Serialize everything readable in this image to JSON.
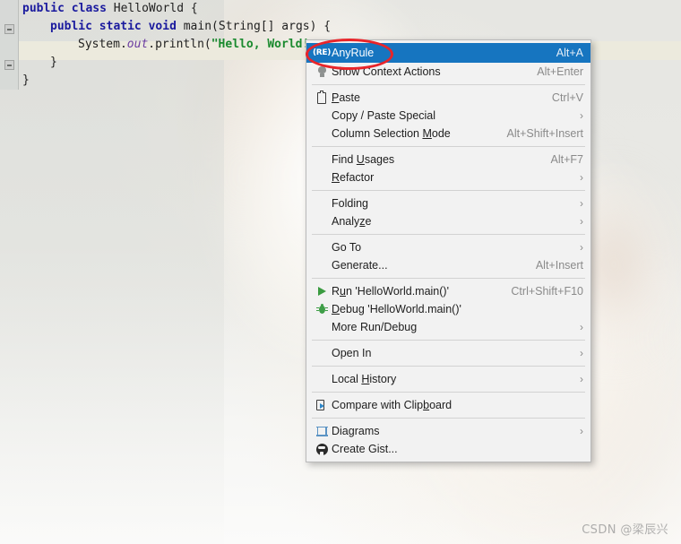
{
  "editor": {
    "lines": [
      {
        "indent": 0,
        "tokens": [
          {
            "t": "public",
            "c": "kw"
          },
          {
            "t": " ",
            "c": "pln"
          },
          {
            "t": "class",
            "c": "kw"
          },
          {
            "t": " HelloWorld {",
            "c": "pln"
          }
        ]
      },
      {
        "indent": 1,
        "tokens": [
          {
            "t": "public",
            "c": "kw"
          },
          {
            "t": " ",
            "c": "pln"
          },
          {
            "t": "static",
            "c": "kw"
          },
          {
            "t": " ",
            "c": "pln"
          },
          {
            "t": "void",
            "c": "kw"
          },
          {
            "t": " main(String[] args) {",
            "c": "pln"
          }
        ]
      },
      {
        "indent": 2,
        "tokens": [
          {
            "t": "System.",
            "c": "pln"
          },
          {
            "t": "out",
            "c": "fld"
          },
          {
            "t": ".println(",
            "c": "pln"
          },
          {
            "t": "\"Hello, World!",
            "c": "str"
          }
        ]
      },
      {
        "indent": 1,
        "tokens": [
          {
            "t": "}",
            "c": "pln"
          }
        ]
      },
      {
        "indent": 0,
        "tokens": [
          {
            "t": "}",
            "c": "pln"
          }
        ]
      }
    ],
    "highlighted_line_index": 2
  },
  "context_menu": {
    "groups": [
      {
        "items": [
          {
            "label": "AnyRule",
            "accel": "Alt+A",
            "icon": "anyrule-icon",
            "selected": true,
            "arrow": false,
            "mnemonic": ""
          },
          {
            "label": "Show Context Actions",
            "accel": "Alt+Enter",
            "icon": "lightbulb-icon",
            "selected": false,
            "arrow": false,
            "mnemonic": ""
          }
        ]
      },
      {
        "items": [
          {
            "label": "Paste",
            "accel": "Ctrl+V",
            "icon": "clipboard-icon",
            "selected": false,
            "arrow": false,
            "mnemonic": "P"
          },
          {
            "label": "Copy / Paste Special",
            "accel": "",
            "icon": "",
            "selected": false,
            "arrow": true,
            "mnemonic": ""
          },
          {
            "label": "Column Selection Mode",
            "accel": "Alt+Shift+Insert",
            "icon": "",
            "selected": false,
            "arrow": false,
            "mnemonic": "M"
          }
        ]
      },
      {
        "items": [
          {
            "label": "Find Usages",
            "accel": "Alt+F7",
            "icon": "",
            "selected": false,
            "arrow": false,
            "mnemonic": "U"
          },
          {
            "label": "Refactor",
            "accel": "",
            "icon": "",
            "selected": false,
            "arrow": true,
            "mnemonic": "R"
          }
        ]
      },
      {
        "items": [
          {
            "label": "Folding",
            "accel": "",
            "icon": "",
            "selected": false,
            "arrow": true,
            "mnemonic": ""
          },
          {
            "label": "Analyze",
            "accel": "",
            "icon": "",
            "selected": false,
            "arrow": true,
            "mnemonic": "z"
          }
        ]
      },
      {
        "items": [
          {
            "label": "Go To",
            "accel": "",
            "icon": "",
            "selected": false,
            "arrow": true,
            "mnemonic": ""
          },
          {
            "label": "Generate...",
            "accel": "Alt+Insert",
            "icon": "",
            "selected": false,
            "arrow": false,
            "mnemonic": ""
          }
        ]
      },
      {
        "items": [
          {
            "label": "Run 'HelloWorld.main()'",
            "accel": "Ctrl+Shift+F10",
            "icon": "run-play-icon",
            "selected": false,
            "arrow": false,
            "mnemonic": "u"
          },
          {
            "label": "Debug 'HelloWorld.main()'",
            "accel": "",
            "icon": "debug-bug-icon",
            "selected": false,
            "arrow": false,
            "mnemonic": "D"
          },
          {
            "label": "More Run/Debug",
            "accel": "",
            "icon": "",
            "selected": false,
            "arrow": true,
            "mnemonic": ""
          }
        ]
      },
      {
        "items": [
          {
            "label": "Open In",
            "accel": "",
            "icon": "",
            "selected": false,
            "arrow": true,
            "mnemonic": ""
          }
        ]
      },
      {
        "items": [
          {
            "label": "Local History",
            "accel": "",
            "icon": "",
            "selected": false,
            "arrow": true,
            "mnemonic": "H"
          }
        ]
      },
      {
        "items": [
          {
            "label": "Compare with Clipboard",
            "accel": "",
            "icon": "compare-clipboard-icon",
            "selected": false,
            "arrow": false,
            "mnemonic": "b"
          }
        ]
      },
      {
        "items": [
          {
            "label": "Diagrams",
            "accel": "",
            "icon": "diagrams-icon",
            "selected": false,
            "arrow": true,
            "mnemonic": ""
          },
          {
            "label": "Create Gist...",
            "accel": "",
            "icon": "github-icon",
            "selected": false,
            "arrow": false,
            "mnemonic": ""
          }
        ]
      }
    ],
    "anyrule_icon_text": "(RE)"
  },
  "annotation": {
    "shape": "ellipse",
    "color": "#e8252a",
    "target": "AnyRule"
  },
  "watermark": {
    "text": "CSDN @梁辰兴"
  },
  "colors": {
    "selection_blue": "#1675c0",
    "menu_background": "#f2f2f2",
    "annotation_red": "#e8252a",
    "keyword_blue": "#1a1a9e",
    "string_green": "#1a8a2e",
    "field_purple": "#6a3ca0",
    "line_highlight": "#eceadd"
  }
}
